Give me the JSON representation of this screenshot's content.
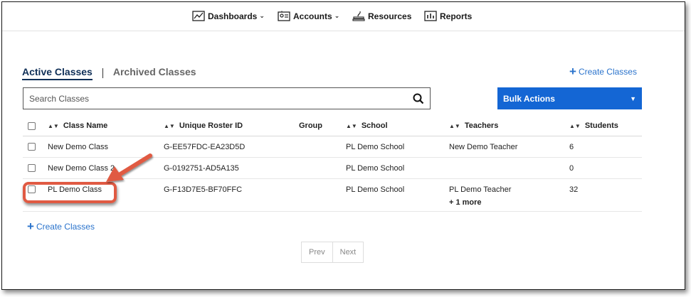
{
  "nav": {
    "items": [
      {
        "label": "Dashboards",
        "has_dropdown": true,
        "icon": "chart-icon"
      },
      {
        "label": "Accounts",
        "has_dropdown": true,
        "icon": "accounts-icon"
      },
      {
        "label": "Resources",
        "has_dropdown": false,
        "icon": "resources-icon"
      },
      {
        "label": "Reports",
        "has_dropdown": false,
        "icon": "reports-icon"
      }
    ]
  },
  "tabs": {
    "active": "Active Classes",
    "archived": "Archived Classes"
  },
  "create_classes_label": "Create Classes",
  "search": {
    "placeholder": "Search Classes"
  },
  "bulk_actions_label": "Bulk Actions",
  "table": {
    "headers": {
      "class_name": "Class Name",
      "roster_id": "Unique Roster ID",
      "group": "Group",
      "school": "School",
      "teachers": "Teachers",
      "students": "Students"
    },
    "rows": [
      {
        "class_name": "New Demo Class",
        "roster_id": "G-EE57FDC-EA23D5D",
        "group": "",
        "school": "PL Demo School",
        "teachers": "New Demo Teacher",
        "teachers_more": "",
        "students": "6"
      },
      {
        "class_name": "New Demo Class 2",
        "roster_id": "G-0192751-AD5A135",
        "group": "",
        "school": "PL Demo School",
        "teachers": "",
        "teachers_more": "",
        "students": "0"
      },
      {
        "class_name": "PL Demo Class",
        "roster_id": "G-F13D7E5-BF70FFC",
        "group": "",
        "school": "PL Demo School",
        "teachers": "PL Demo Teacher",
        "teachers_more": "+ 1 more",
        "students": "32"
      }
    ]
  },
  "pagination": {
    "prev": "Prev",
    "next": "Next"
  },
  "colors": {
    "accent": "#1466d4",
    "link": "#2a73cc",
    "highlight": "#e05a43"
  }
}
